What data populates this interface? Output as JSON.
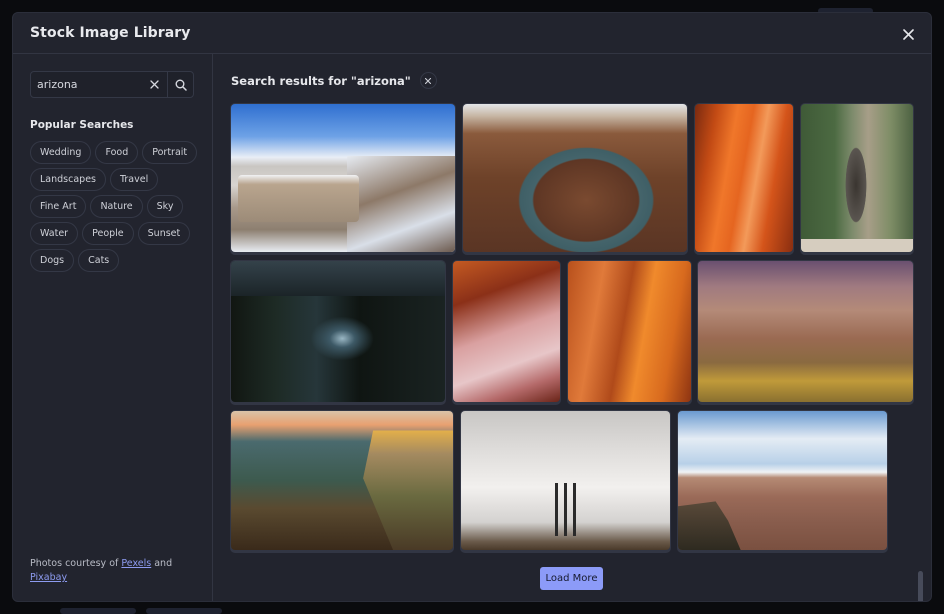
{
  "modal": {
    "title": "Stock Image Library",
    "close_icon": "close-icon"
  },
  "sidebar": {
    "search": {
      "value": "arizona",
      "placeholder": "Search images",
      "clear_icon": "clear-icon",
      "search_icon": "search-icon"
    },
    "popular_title": "Popular Searches",
    "popular_tags": [
      "Wedding",
      "Food",
      "Portrait",
      "Landscapes",
      "Travel",
      "Fine Art",
      "Nature",
      "Sky",
      "Water",
      "People",
      "Sunset",
      "Dogs",
      "Cats"
    ],
    "credits": {
      "prefix": "Photos courtesy of ",
      "link1": "Pexels",
      "middle": " and",
      "link2": "Pixabay"
    }
  },
  "main": {
    "results_title": "Search results for \"arizona\"",
    "clear_results_icon": "close-icon",
    "images": [
      {
        "name": "grand-canyon-snow",
        "style": "p1"
      },
      {
        "name": "horseshoe-bend",
        "style": "p2"
      },
      {
        "name": "antelope-canyon-orange",
        "style": "p3"
      },
      {
        "name": "roadrunner-cactus",
        "style": "p4"
      },
      {
        "name": "waterfall-night",
        "style": "p5"
      },
      {
        "name": "antelope-canyon-pink",
        "style": "p6"
      },
      {
        "name": "antelope-canyon-light",
        "style": "p7"
      },
      {
        "name": "grand-canyon-tree",
        "style": "p8"
      },
      {
        "name": "grand-canyon-sunset",
        "style": "p9"
      },
      {
        "name": "power-plant-smoke",
        "style": "p10"
      },
      {
        "name": "grand-canyon-vista",
        "style": "p11"
      }
    ],
    "load_more_label": "Load More"
  },
  "colors": {
    "accent": "#8c9bf8",
    "link": "#8d9bf0",
    "modal_bg": "#22242e"
  }
}
